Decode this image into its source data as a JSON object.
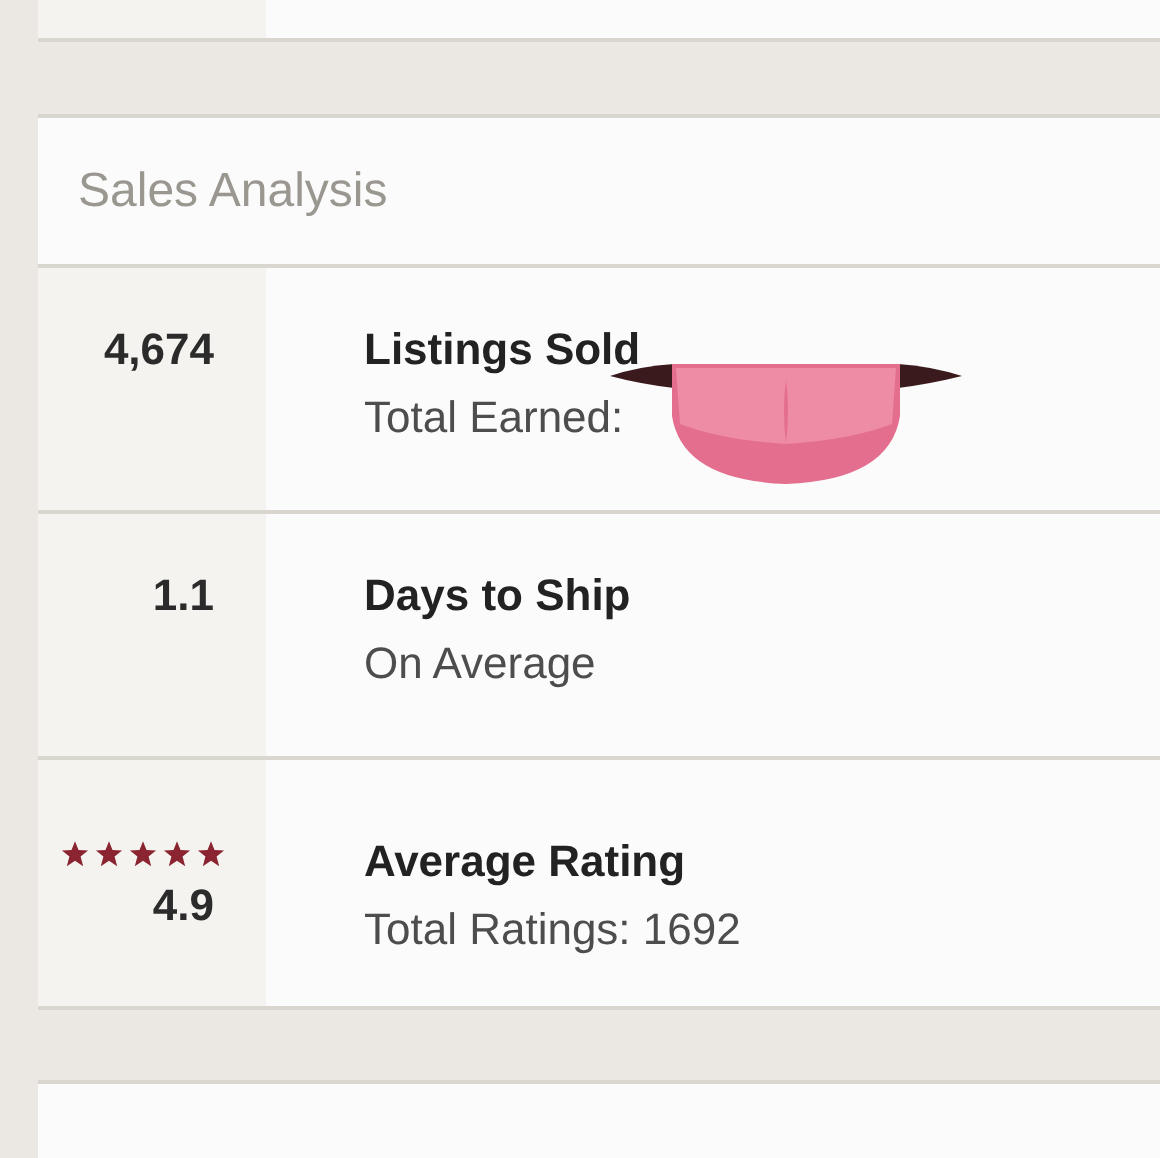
{
  "section": {
    "title": "Sales Analysis"
  },
  "stats": [
    {
      "kind": "number",
      "value": "4,674",
      "title": "Listings Sold",
      "subtitle": "Total Earned:",
      "covered_by_sticker": true
    },
    {
      "kind": "number",
      "value": "1.1",
      "title": "Days to Ship",
      "subtitle": "On Average",
      "covered_by_sticker": false
    },
    {
      "kind": "rating",
      "value": "4.9",
      "stars": 5,
      "title": "Average Rating",
      "subtitle": "Total Ratings: 1692",
      "covered_by_sticker": false
    }
  ]
}
